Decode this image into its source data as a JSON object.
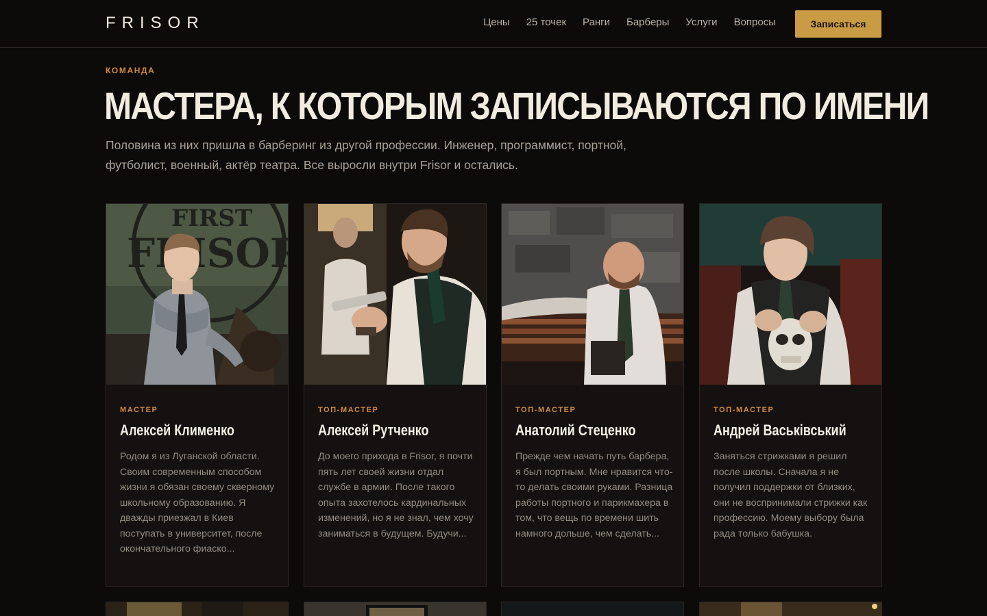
{
  "header": {
    "logo": "FRISOR",
    "nav": [
      "Цены",
      "25 точек",
      "Ранги",
      "Барберы",
      "Услуги",
      "Вопросы"
    ],
    "cta": "Записаться"
  },
  "intro": {
    "kicker": "КОМАНДА",
    "title": "МАСТЕРА, К КОТОРЫМ ЗАПИСЫВАЮТСЯ ПО ИМЕНИ",
    "lead": "Половина из них пришла в барберинг из другой профессии. Инженер, программист, портной, футболист, военный, актёр театра. Все выросли внутри Frisor и остались."
  },
  "barbers": [
    {
      "role": "МАСТЕР",
      "name": "Алексей Клименко",
      "bio": "Родом я из Луганской области. Своим современным способом жизни я обязан своему скверному школьному образованию. Я дважды приезжал в Киев поступать в университет, после окончательного фиаско..."
    },
    {
      "role": "ТОП-МАСТЕР",
      "name": "Алексей Рутченко",
      "bio": "До моего прихода в Frisor, я почти пять лет своей жизни отдал службе в армии. После такого опыта захотелось кардинальных изменений, но я не знал, чем хочу заниматься в будущем. Будучи..."
    },
    {
      "role": "ТОП-МАСТЕР",
      "name": "Анатолий Стеценко",
      "bio": "Прежде чем начать путь барбера, я был портным. Мне нравится что-то делать своими руками. Разница работы портного и парикмахера в том, что вещь по времени шить намного дольше, чем сделать..."
    },
    {
      "role": "ТОП-МАСТЕР",
      "name": "Андрей Васьківський",
      "bio": "Заняться стрижками я решил после школы. Сначала я не получил поддержки от близких, они не воспринимали стрижки как профессию. Моему выбору была рада только бабушка."
    }
  ],
  "photo_sign": [
    "FIRST",
    "FRISOR"
  ],
  "colors": {
    "accent": "#c99b45",
    "kicker": "#d38a3e",
    "background": "#0d0b0a",
    "card": "#141110"
  }
}
